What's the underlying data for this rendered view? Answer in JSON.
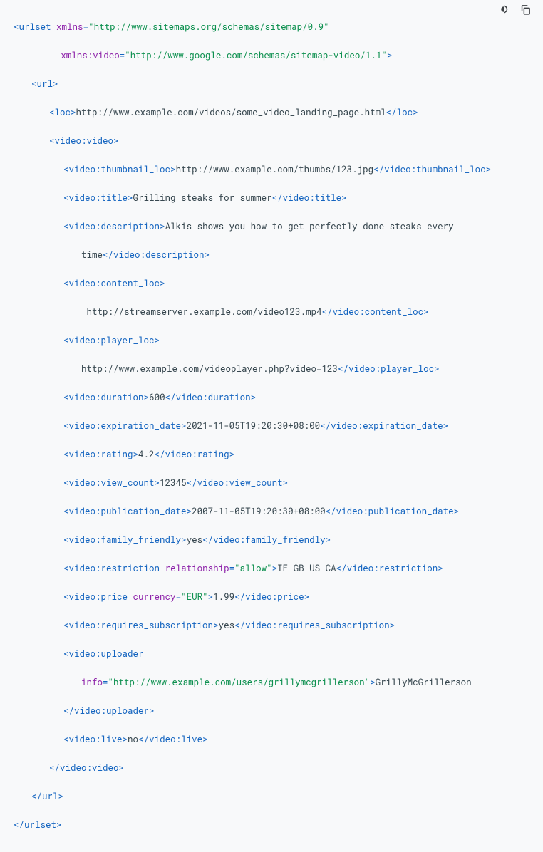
{
  "toolbar": {
    "theme_icon": "theme-toggle-icon",
    "copy_icon": "copy-icon"
  },
  "code": {
    "urlset": {
      "xmlns": "http://www.sitemaps.org/schemas/sitemap/0.9",
      "xmlns_video_attr": "xmlns:video",
      "xmlns_video": "http://www.google.com/schemas/sitemap-video/1.1"
    },
    "url_tag": "url",
    "loc_tag": "loc",
    "loc": "http://www.example.com/videos/some_video_landing_page.html",
    "video_tag": "video:video",
    "thumbnail_tag": "video:thumbnail_loc",
    "thumbnail": "http://www.example.com/thumbs/123.jpg",
    "title_tag": "video:title",
    "title": "Grilling steaks for summer",
    "description_tag": "video:description",
    "description_l1": "Alkis shows you how to get perfectly done steaks every",
    "description_l2": "time",
    "content_loc_tag": "video:content_loc",
    "content_loc": "http://streamserver.example.com/video123.mp4",
    "player_loc_tag": "video:player_loc",
    "player_loc": "http://www.example.com/videoplayer.php?video=123",
    "duration_tag": "video:duration",
    "duration": "600",
    "expiration_tag": "video:expiration_date",
    "expiration": "2021-11-05T19:20:30+08:00",
    "rating_tag": "video:rating",
    "rating": "4.2",
    "view_count_tag": "video:view_count",
    "view_count": "12345",
    "publication_tag": "video:publication_date",
    "publication": "2007-11-05T19:20:30+08:00",
    "family_tag": "video:family_friendly",
    "family": "yes",
    "restriction_tag": "video:restriction",
    "restriction_rel_attr": "relationship",
    "restriction_rel": "allow",
    "restriction": "IE GB US CA",
    "price_tag": "video:price",
    "price_cur_attr": "currency",
    "price_cur": "EUR",
    "price": "1.99",
    "requires_sub_tag": "video:requires_subscription",
    "requires_sub": "yes",
    "uploader_tag": "video:uploader",
    "uploader_info_attr": "info",
    "uploader_info": "http://www.example.com/users/grillymcgrillerson",
    "uploader": "GrillyMcGrillerson",
    "live_tag": "video:live",
    "live": "no",
    "urlset_tag": "urlset",
    "xmlns_attr": "xmlns"
  }
}
